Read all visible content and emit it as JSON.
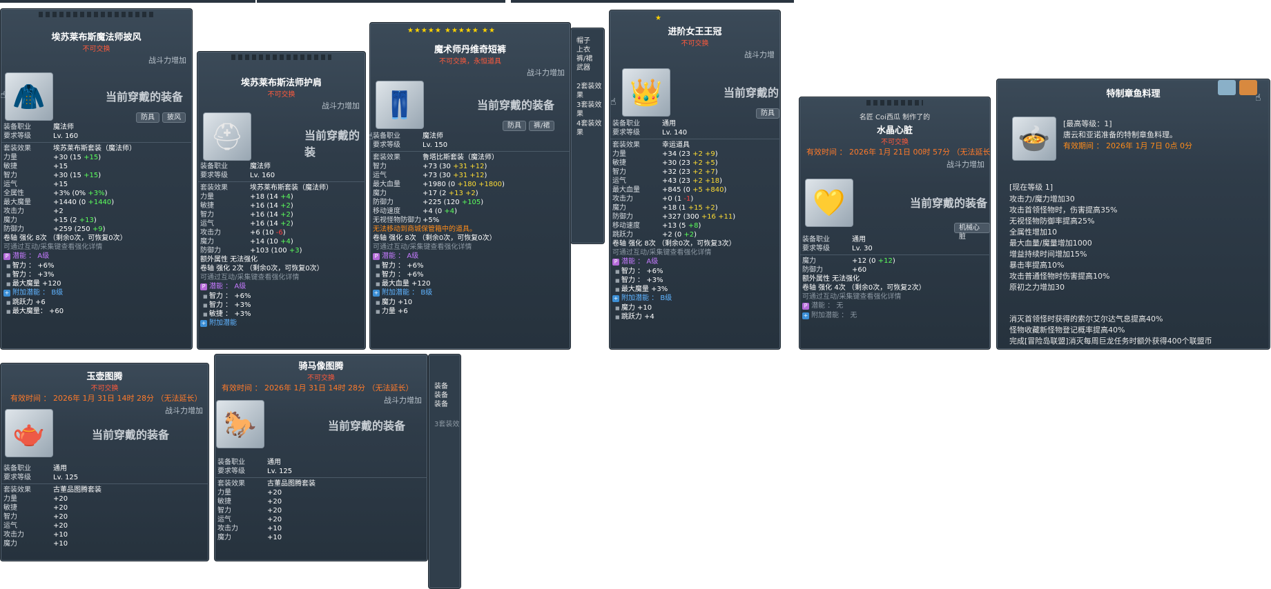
{
  "p1": {
    "title": "埃苏莱布斯魔法师披风",
    "untradable": "不可交换",
    "bp": "战斗力增加",
    "equipped": "当前穿戴的装备",
    "tags": [
      "防具",
      "披风"
    ],
    "rows": [
      [
        "装备职业",
        "魔法师"
      ],
      [
        "要求等级",
        "Lv. 160"
      ]
    ],
    "set": [
      "套装效果",
      "埃苏莱布斯套装（魔法师）"
    ],
    "stats": [
      [
        "力量",
        "+30 (15 ",
        "+15",
        ")"
      ],
      [
        "敏捷",
        "+15",
        "",
        ""
      ],
      [
        "智力",
        "+30 (15 ",
        "+15",
        ")"
      ],
      [
        "运气",
        "+15",
        "",
        ""
      ],
      [
        "全属性",
        "+3% (0% ",
        "+3%",
        ")"
      ],
      [
        "最大魔量",
        "+1440 (0 ",
        "+1440",
        ")"
      ],
      [
        "攻击力",
        "+2",
        "",
        ""
      ],
      [
        "魔力",
        "+15 (2 ",
        "+13",
        ")"
      ],
      [
        "防御力",
        "+259 (250 ",
        "+9",
        ")"
      ]
    ],
    "scroll": "卷轴 强化 8次 （剩余0次，可恢复0次）",
    "hint": "可通过互动/采集键查看强化详情",
    "pot": "潜能 ： A级",
    "potlines": [
      "智力 ： +6%",
      "智力 ： +3%",
      "最大魔量 +120"
    ],
    "addpot": "附加潜能 ： B级",
    "addlines": [
      "跳跃力 +6",
      "最大魔量： +60"
    ]
  },
  "p2": {
    "title": "埃苏莱布斯法师护肩",
    "untradable": "不可交换",
    "bp": "战斗力增加",
    "equipped": "当前穿戴的装",
    "rows": [
      [
        "装备职业",
        "魔法师"
      ],
      [
        "要求等级",
        "Lv. 160"
      ]
    ],
    "set": [
      "套装效果",
      "埃苏莱布斯套装（魔法师）"
    ],
    "stats": [
      [
        "力量",
        "+18 (14 ",
        "+4",
        ")"
      ],
      [
        "敏捷",
        "+16 (14 ",
        "+2",
        ")"
      ],
      [
        "智力",
        "+16 (14 ",
        "+2",
        ")"
      ],
      [
        "运气",
        "+16 (14 ",
        "+2",
        ")"
      ],
      [
        "攻击力",
        "+6 (10 ",
        "-6",
        ")"
      ],
      [
        "魔力",
        "+14 (10 ",
        "+4",
        ")"
      ],
      [
        "防御力",
        "+103 (100 ",
        "+3",
        ")"
      ]
    ],
    "extra": "额外属性 无法强化",
    "scroll": "卷轴 强化 2次 （剩余0次，可恢复0次）",
    "hint": "可通过互动/采集键查看强化详情",
    "pot": "潜能 ： A级",
    "potlines": [
      "智力 ： +6%",
      "智力 ： +3%",
      "敏捷 ： +3%"
    ],
    "addpot": "附加潜能"
  },
  "p3": {
    "stars": "★★★★★ ★★★★★ ★★",
    "title": "魔术师丹维奇短裤",
    "untradable": "不可交换，永恒道具",
    "bp": "战斗力增加",
    "equipped": "当前穿戴的装备",
    "tags": [
      "防具",
      "裤/裙"
    ],
    "rows": [
      [
        "装备职业",
        "魔法师"
      ],
      [
        "要求等级",
        "Lv. 150"
      ]
    ],
    "set": [
      "套装效果",
      "鲁塔比斯套装（魔法师）"
    ],
    "stats": [
      [
        "智力",
        "+73 (30 ",
        "+31 +12",
        ")"
      ],
      [
        "运气",
        "+73 (30 ",
        "+31 +12",
        ")"
      ],
      [
        "最大血量",
        "+1980 (0 ",
        "+180 +1800",
        ")"
      ],
      [
        "魔力",
        "+17 (2 ",
        "+13 +2",
        ")"
      ],
      [
        "防御力",
        "+225 (120 ",
        "+105",
        ")"
      ],
      [
        "移动速度",
        "+4 (0 ",
        "+4",
        ")"
      ],
      [
        "无视怪物防御力",
        "+5%",
        "",
        ""
      ]
    ],
    "warn": "无法移动到商城保管箱中的道具。",
    "scroll": "卷轴 强化 8次 （剩余0次，可恢复0次）",
    "hint": "可通过互动/采集键查看强化详情",
    "pot": "潜能 ： A级",
    "potlines": [
      "智力 ： +6%",
      "智力 ： +6%",
      "最大血量 +120"
    ],
    "addpot": "附加潜能 ： B级",
    "addlines": [
      "魔力 +10",
      "力量 +6"
    ],
    "side": [
      "帽子",
      "上衣",
      "裤/裙",
      "武器",
      "2套装效果",
      "3套装效果",
      "4套装效果"
    ]
  },
  "p4": {
    "stars": "★",
    "title": "进阶女王王冠",
    "untradable": "不可交换",
    "bp": "战斗力增",
    "equipped": "当前穿戴的",
    "tags": [
      "防具"
    ],
    "rows": [
      [
        "装备职业",
        "通用"
      ],
      [
        "要求等级",
        "Lv. 140"
      ]
    ],
    "set": [
      "套装效果",
      "幸运道具"
    ],
    "stats": [
      [
        "力量",
        "+34 (23 ",
        "+2 +9",
        ")"
      ],
      [
        "敏捷",
        "+30 (23 ",
        "+2 +5",
        ")"
      ],
      [
        "智力",
        "+32 (23 ",
        "+2 +7",
        ")"
      ],
      [
        "运气",
        "+43 (23 ",
        "+2 +18",
        ")"
      ],
      [
        "最大血量",
        "+845 (0 ",
        "+5 +840",
        ")"
      ],
      [
        "攻击力",
        "+0 (1 ",
        "-1",
        ")"
      ],
      [
        "魔力",
        "+18 (1 ",
        "+15 +2",
        ")"
      ],
      [
        "防御力",
        "+327 (300 ",
        "+16 +11",
        ")"
      ],
      [
        "移动速度",
        "+13 (5 ",
        "+8",
        ")"
      ],
      [
        "跳跃力",
        "+2 (0 ",
        "+2",
        ")"
      ]
    ],
    "scroll": "卷轴 强化 8次 （剩余0次，可恢复3次）",
    "hint": "可通过互动/采集键查看强化详情",
    "pot": "潜能 ： A级",
    "potlines": [
      "智力 ： +6%",
      "智力 ： +3%",
      "最大魔量 +3%"
    ],
    "addpot": "附加潜能 ： B级",
    "addlines": [
      "魔力 +10",
      "跳跃力 +4"
    ]
  },
  "p5": {
    "maker": "名匠 Coi西瓜 制作了的",
    "title": "水晶心脏",
    "untradable": "不可交换",
    "expire": "有效时间 ： 2026年 1月 21日 00时 57分 （无法延长）",
    "bp": "战斗力增加",
    "equipped": "当前穿戴的装备",
    "tag": "机械心脏",
    "rows": [
      [
        "装备职业",
        "通用"
      ],
      [
        "要求等级",
        "Lv. 30"
      ]
    ],
    "stats": [
      [
        "魔力",
        "+12 (0 ",
        "+12",
        ")"
      ],
      [
        "防御力",
        "+60",
        "",
        ""
      ]
    ],
    "extra": "额外属性 无法强化",
    "scroll": "卷轴 强化 4次 （剩余0次，可恢复2次）",
    "hint": "可通过互动/采集键查看强化详情",
    "pot": "潜能 ： 无",
    "addpot": "附加潜能 ： 无"
  },
  "p6": {
    "title": "特制章鱼料理",
    "lvl": "[最高等级：1]",
    "desc": "唐云和亚诺准备的特制章鱼料理。",
    "expire": "有效期间 ： 2026年 1月 7日 0点 0分",
    "cur": "[现在等级 1]",
    "effects": [
      "攻击力/魔力增加30",
      "攻击首领怪物时，伤害提高35%",
      "无视怪物防御率提高25%",
      "全属性增加10",
      "最大血量/魔量增加1000",
      "增益持续时间增加15%",
      "暴击率提高10%",
      "攻击普通怪物时伤害提高10%",
      "原初之力增加30"
    ],
    "extra": [
      "消灭首领怪时获得的索尔艾尔达气息提高40%",
      "怪物收藏新怪物登记概率提高40%",
      "完成[冒险岛联盟]消灭每周巨龙任务时额外获得400个联盟币"
    ]
  },
  "p7": {
    "title": "玉壶图腾",
    "untradable": "不可交换",
    "expire": "有效时间 ： 2026年 1月 31日 14时 28分 （无法延长）",
    "bp": "战斗力增加",
    "equipped": "当前穿戴的装备",
    "rows": [
      [
        "装备职业",
        "通用"
      ],
      [
        "要求等级",
        "Lv. 125"
      ]
    ],
    "set": [
      "套装效果",
      "古董品图腾套装"
    ],
    "stats": [
      [
        "力量",
        "+20",
        "",
        ""
      ],
      [
        "敏捷",
        "+20",
        "",
        ""
      ],
      [
        "智力",
        "+20",
        "",
        ""
      ],
      [
        "运气",
        "+20",
        "",
        ""
      ],
      [
        "攻击力",
        "+10",
        "",
        ""
      ],
      [
        "魔力",
        "+10",
        "",
        ""
      ]
    ]
  },
  "p8": {
    "title": "骑马像图腾",
    "untradable": "不可交换",
    "expire": "有效时间 ： 2026年 1月 31日 14时 28分 （无法延长）",
    "bp": "战斗力增加",
    "equipped": "当前穿戴的装备",
    "rows": [
      [
        "装备职业",
        "通用"
      ],
      [
        "要求等级",
        "Lv. 125"
      ]
    ],
    "set": [
      "套装效果",
      "古董品图腾套装"
    ],
    "stats": [
      [
        "力量",
        "+20",
        "",
        ""
      ],
      [
        "敏捷",
        "+20",
        "",
        ""
      ],
      [
        "智力",
        "+20",
        "",
        ""
      ],
      [
        "运气",
        "+20",
        "",
        ""
      ],
      [
        "攻击力",
        "+10",
        "",
        ""
      ],
      [
        "魔力",
        "+10",
        "",
        ""
      ]
    ],
    "side": [
      "装备",
      "装备",
      "装备",
      "3套装效"
    ]
  }
}
